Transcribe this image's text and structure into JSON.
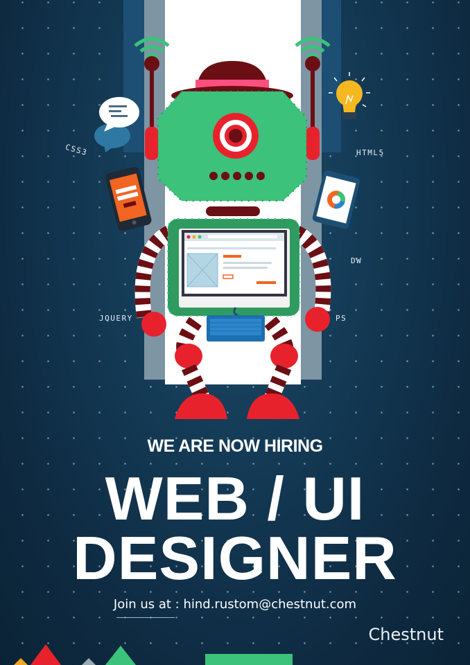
{
  "skills": {
    "css": "CSS3",
    "html": "HTML5",
    "dw": "DW",
    "jquery": "JQUERY",
    "ps": "PS"
  },
  "headline": {
    "hiring": "WE ARE NOW HIRING",
    "role_line_1": "WEB / UI",
    "role_line_2": "DESIGNER"
  },
  "contact": {
    "text": "Join us at : hind.rustom@chestnut.com"
  },
  "brand": {
    "name": "Chestnut"
  },
  "colors": {
    "background": "#143a55",
    "robot_head": "#3cc27a",
    "robot_red": "#e8222d",
    "robot_dark": "#6b0f14",
    "hat_band": "#ff4f7f",
    "screen_border": "#2f9b60",
    "footer_green": "#3cc27a"
  },
  "icons": [
    "wifi-signal-icon",
    "speech-bubble-icon",
    "lightbulb-icon",
    "smartphone-icon",
    "tablet-chart-icon",
    "keyboard-icon"
  ]
}
